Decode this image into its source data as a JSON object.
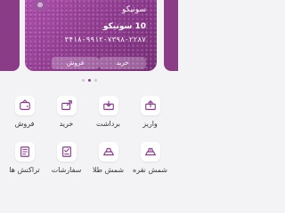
{
  "card": {
    "badge": "⊕",
    "name": "سونیکو",
    "balance": "10 سونیکو",
    "number": "۳۴۱۸-۹۹۱۲-۷۳۹۸-۲۲۸۷",
    "buy_label": "خرید",
    "sell_label": "فروش"
  },
  "carousel": {
    "pages": 3,
    "active": 1
  },
  "actions": [
    {
      "label": "واریز",
      "icon": "deposit-icon"
    },
    {
      "label": "برداشت",
      "icon": "withdraw-icon"
    },
    {
      "label": "خرید",
      "icon": "buy-icon"
    },
    {
      "label": "فروش",
      "icon": "sell-icon"
    },
    {
      "label": "شمش نقره",
      "icon": "silver-bar-icon"
    },
    {
      "label": "شمش طلا",
      "icon": "gold-bar-icon"
    },
    {
      "label": "سفارشات",
      "icon": "orders-icon"
    },
    {
      "label": "تراکنش ها",
      "icon": "transactions-icon"
    }
  ],
  "colors": {
    "accent": "#8b3a8b",
    "card": "#9b459b"
  }
}
